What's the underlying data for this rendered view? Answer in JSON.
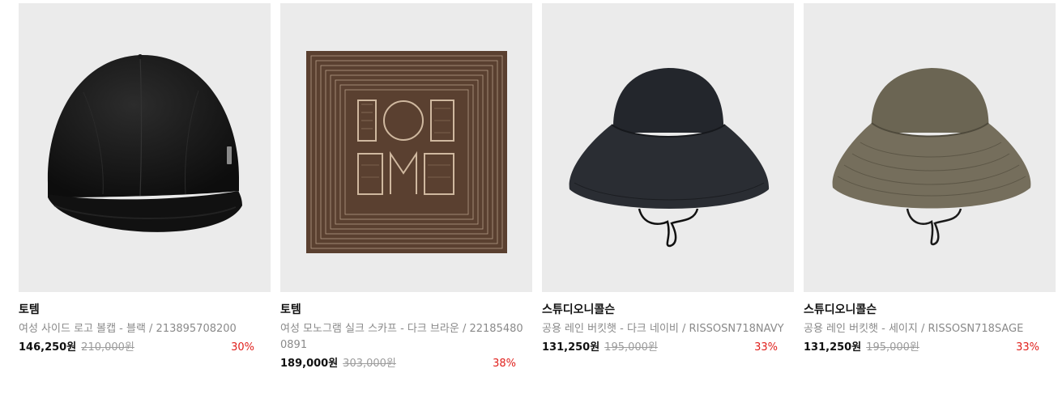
{
  "products": [
    {
      "image_icon": "black-baseball-cap-icon",
      "brand": "토템",
      "name": "여성 사이드 로고 볼캡 - 블랙 / 213895708200",
      "price": "146,250원",
      "original_price": "210,000원",
      "discount": "30%"
    },
    {
      "image_icon": "brown-monogram-silk-scarf-icon",
      "brand": "토템",
      "name": "여성 모노그램 실크 스카프 - 다크 브라운 / 221854800891",
      "price": "189,000원",
      "original_price": "303,000원",
      "discount": "38%"
    },
    {
      "image_icon": "navy-bucket-hat-icon",
      "brand": "스튜디오니콜슨",
      "name": "공용 레인 버킷햇 - 다크 네이비 / RISSOSN718NAVY",
      "price": "131,250원",
      "original_price": "195,000원",
      "discount": "33%"
    },
    {
      "image_icon": "sage-bucket-hat-icon",
      "brand": "스튜디오니콜슨",
      "name": "공용 레인 버킷햇 - 세이지 / RISSOSN718SAGE",
      "price": "131,250원",
      "original_price": "195,000원",
      "discount": "33%"
    }
  ],
  "colors": {
    "discount": "#e0201c",
    "thumb_background": "#ebebeb",
    "muted_text": "#8a8a8a"
  }
}
